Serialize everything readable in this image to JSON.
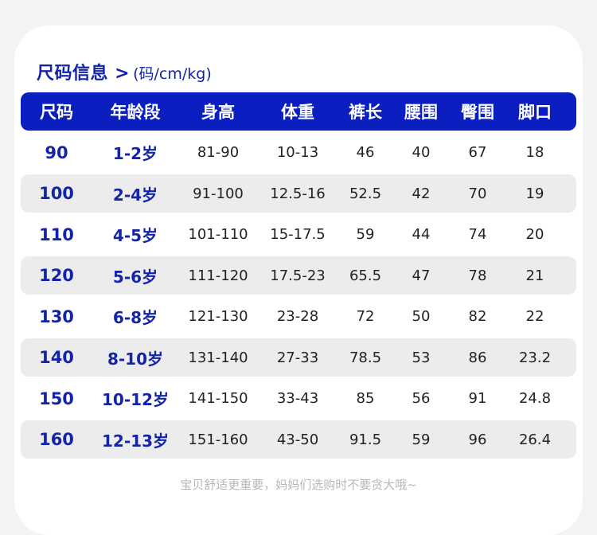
{
  "title": "尺码信息 >",
  "unit_note": "(码/cm/kg)",
  "table": {
    "headers": [
      "尺码",
      "年龄段",
      "身高",
      "体重",
      "裤长",
      "腰围",
      "臀围",
      "脚口"
    ],
    "rows": [
      [
        "90",
        "1-2岁",
        "81-90",
        "10-13",
        "46",
        "40",
        "67",
        "18"
      ],
      [
        "100",
        "2-4岁",
        "91-100",
        "12.5-16",
        "52.5",
        "42",
        "70",
        "19"
      ],
      [
        "110",
        "4-5岁",
        "101-110",
        "15-17.5",
        "59",
        "44",
        "74",
        "20"
      ],
      [
        "120",
        "5-6岁",
        "111-120",
        "17.5-23",
        "65.5",
        "47",
        "78",
        "21"
      ],
      [
        "130",
        "6-8岁",
        "121-130",
        "23-28",
        "72",
        "50",
        "82",
        "22"
      ],
      [
        "140",
        "8-10岁",
        "131-140",
        "27-33",
        "78.5",
        "53",
        "86",
        "23.2"
      ],
      [
        "150",
        "10-12岁",
        "141-150",
        "33-43",
        "85",
        "56",
        "91",
        "24.8"
      ],
      [
        "160",
        "12-13岁",
        "151-160",
        "43-50",
        "91.5",
        "59",
        "96",
        "26.4"
      ]
    ]
  },
  "footer_note": "宝贝舒适更重要，妈妈们选购时不要贪大哦~",
  "colors": {
    "accent": "#0b1fc0",
    "text_blue": "#1424a8",
    "row_alt": "#ececec",
    "background": "#f3f3f3",
    "footer_text": "#b7b7b7"
  }
}
